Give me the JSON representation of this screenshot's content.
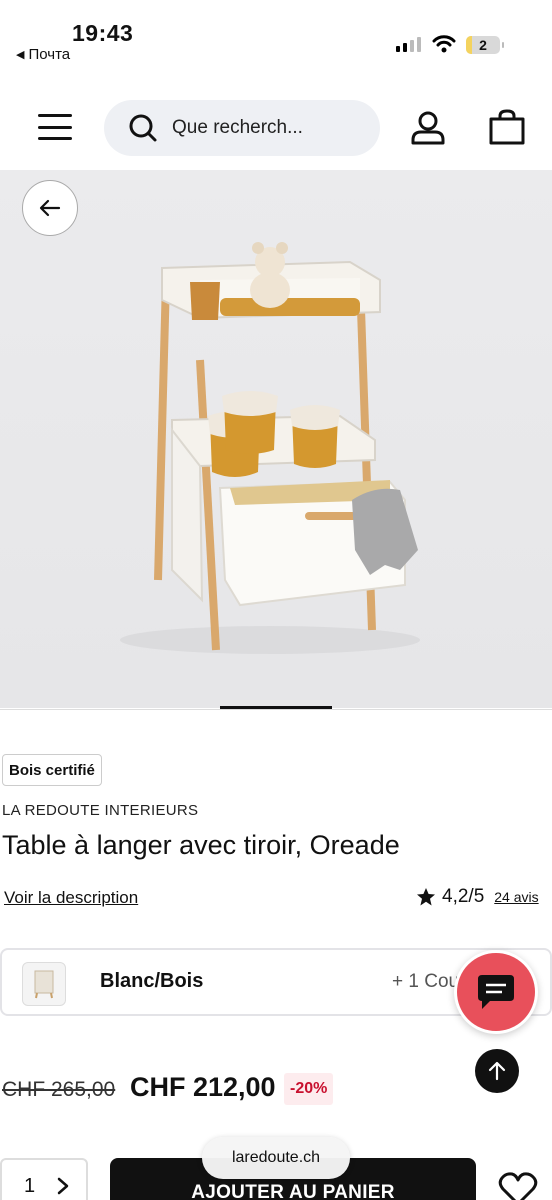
{
  "status_bar": {
    "time": "19:43",
    "back_app": "Почта",
    "battery": "2"
  },
  "header": {
    "search_placeholder": "Que recherch..."
  },
  "product": {
    "badge": "Bois certifié",
    "brand": "LA REDOUTE INTERIEURS",
    "title": "Table à langer avec tiroir, Oreade",
    "description_link": "Voir la description",
    "rating": "4,2/5",
    "reviews": "24 avis",
    "variant_name": "Blanc/Bois",
    "variant_more": "+ 1 Cou",
    "old_price": "CHF 265,00",
    "price": "CHF 212,00",
    "discount": "-20%",
    "quantity": "1",
    "add_to_cart": "AJOUTER AU PANIER"
  },
  "browser": {
    "url": "laredoute.ch"
  },
  "colors": {
    "accent_red": "#e8505b",
    "discount_red": "#c8102e",
    "primary_dark": "#111111"
  }
}
